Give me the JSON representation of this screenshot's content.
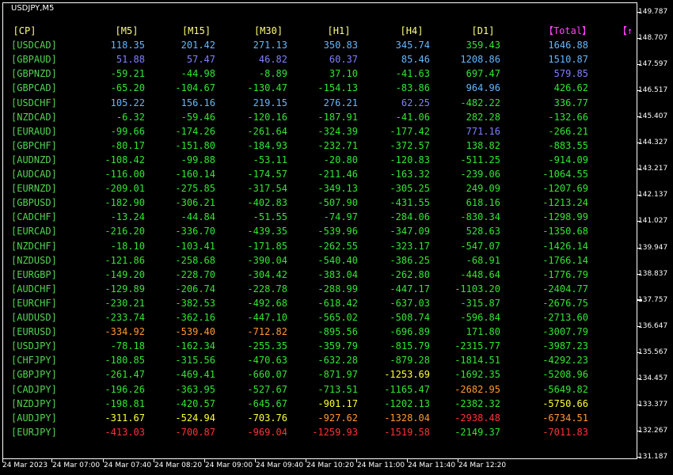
{
  "window": {
    "symbol_title": "USDJPY,M5"
  },
  "colors": {
    "header_yellow": "#ffff80",
    "total_magenta": "#ff40ff",
    "pair_green": "#52d452",
    "positive_blue": "#3aa9ff",
    "light_blue": "#63b8ff",
    "purple": "#8080ff",
    "green": "#33e633",
    "yellow": "#ffff33",
    "orange": "#ff9933",
    "red": "#ff3333",
    "white": "#ffffff"
  },
  "table": {
    "headers": [
      "[CP]",
      "[M5]",
      "[M15]",
      "[M30]",
      "[H1]",
      "[H4]",
      "[D1]",
      "【Total】",
      "【↑"
    ],
    "rows": [
      {
        "pair": "[USDCAD]",
        "values": [
          "118.35",
          "201.42",
          "271.13",
          "350.83",
          "345.74",
          "359.43",
          "1646.88"
        ],
        "tones": [
          "lightblue",
          "lightblue",
          "lightblue",
          "lightblue",
          "lightblue",
          "green",
          "lightblue"
        ]
      },
      {
        "pair": "[GBPAUD]",
        "values": [
          "51.88",
          "57.47",
          "46.82",
          "60.37",
          "85.46",
          "1208.86",
          "1510.87"
        ],
        "tones": [
          "purple",
          "purple",
          "purple",
          "purple",
          "lightblue",
          "lightblue",
          "lightblue"
        ]
      },
      {
        "pair": "[GBPNZD]",
        "values": [
          "-59.21",
          "-44.98",
          "-8.89",
          "37.10",
          "-41.63",
          "697.47",
          "579.85"
        ],
        "tones": [
          "green",
          "green",
          "green",
          "green",
          "green",
          "green",
          "purple"
        ]
      },
      {
        "pair": "[GBPCAD]",
        "values": [
          "-65.20",
          "-104.67",
          "-130.47",
          "-154.13",
          "-83.86",
          "964.96",
          "426.62"
        ],
        "tones": [
          "green",
          "green",
          "green",
          "green",
          "green",
          "lightblue",
          "green"
        ]
      },
      {
        "pair": "[USDCHF]",
        "values": [
          "105.22",
          "156.16",
          "219.15",
          "276.21",
          "62.25",
          "-482.22",
          "336.77"
        ],
        "tones": [
          "lightblue",
          "lightblue",
          "lightblue",
          "lightblue",
          "purple",
          "green",
          "green"
        ]
      },
      {
        "pair": "[NZDCAD]",
        "values": [
          "-6.32",
          "-59.46",
          "-120.16",
          "-187.91",
          "-41.06",
          "282.28",
          "-132.66"
        ],
        "tones": [
          "green",
          "green",
          "green",
          "green",
          "green",
          "green",
          "green"
        ]
      },
      {
        "pair": "[EURAUD]",
        "values": [
          "-99.66",
          "-174.26",
          "-261.64",
          "-324.39",
          "-177.42",
          "771.16",
          "-266.21"
        ],
        "tones": [
          "green",
          "green",
          "green",
          "green",
          "green",
          "purple",
          "green"
        ]
      },
      {
        "pair": "[GBPCHF]",
        "values": [
          "-80.17",
          "-151.80",
          "-184.93",
          "-232.71",
          "-372.57",
          "138.82",
          "-883.55"
        ],
        "tones": [
          "green",
          "green",
          "green",
          "green",
          "green",
          "green",
          "green"
        ]
      },
      {
        "pair": "[AUDNZD]",
        "values": [
          "-108.42",
          "-99.88",
          "-53.11",
          "-20.80",
          "-120.83",
          "-511.25",
          "-914.09"
        ],
        "tones": [
          "green",
          "green",
          "green",
          "green",
          "green",
          "green",
          "green"
        ]
      },
      {
        "pair": "[AUDCAD]",
        "values": [
          "-116.00",
          "-160.14",
          "-174.57",
          "-211.46",
          "-163.32",
          "-239.06",
          "-1064.55"
        ],
        "tones": [
          "green",
          "green",
          "green",
          "green",
          "green",
          "green",
          "green"
        ]
      },
      {
        "pair": "[EURNZD]",
        "values": [
          "-209.01",
          "-275.85",
          "-317.54",
          "-349.13",
          "-305.25",
          "249.09",
          "-1207.69"
        ],
        "tones": [
          "green",
          "green",
          "green",
          "green",
          "green",
          "green",
          "green"
        ]
      },
      {
        "pair": "[GBPUSD]",
        "values": [
          "-182.90",
          "-306.21",
          "-402.83",
          "-507.90",
          "-431.55",
          "618.16",
          "-1213.24"
        ],
        "tones": [
          "green",
          "green",
          "green",
          "green",
          "green",
          "green",
          "green"
        ]
      },
      {
        "pair": "[CADCHF]",
        "values": [
          "-13.24",
          "-44.84",
          "-51.55",
          "-74.97",
          "-284.06",
          "-830.34",
          "-1298.99"
        ],
        "tones": [
          "green",
          "green",
          "green",
          "green",
          "green",
          "green",
          "green"
        ]
      },
      {
        "pair": "[EURCAD]",
        "values": [
          "-216.20",
          "-336.70",
          "-439.35",
          "-539.96",
          "-347.09",
          "528.63",
          "-1350.68"
        ],
        "tones": [
          "green",
          "green",
          "green",
          "green",
          "green",
          "green",
          "green"
        ]
      },
      {
        "pair": "[NZDCHF]",
        "values": [
          "-18.10",
          "-103.41",
          "-171.85",
          "-262.55",
          "-323.17",
          "-547.07",
          "-1426.14"
        ],
        "tones": [
          "green",
          "green",
          "green",
          "green",
          "green",
          "green",
          "green"
        ]
      },
      {
        "pair": "[NZDUSD]",
        "values": [
          "-121.86",
          "-258.68",
          "-390.04",
          "-540.40",
          "-386.25",
          "-68.91",
          "-1766.14"
        ],
        "tones": [
          "green",
          "green",
          "green",
          "green",
          "green",
          "green",
          "green"
        ]
      },
      {
        "pair": "[EURGBP]",
        "values": [
          "-149.20",
          "-228.70",
          "-304.42",
          "-383.04",
          "-262.80",
          "-448.64",
          "-1776.79"
        ],
        "tones": [
          "green",
          "green",
          "green",
          "green",
          "green",
          "green",
          "green"
        ]
      },
      {
        "pair": "[AUDCHF]",
        "values": [
          "-129.89",
          "-206.74",
          "-228.78",
          "-288.99",
          "-447.17",
          "-1103.20",
          "-2404.77"
        ],
        "tones": [
          "green",
          "green",
          "green",
          "green",
          "green",
          "green",
          "green"
        ]
      },
      {
        "pair": "[EURCHF]",
        "values": [
          "-230.21",
          "-382.53",
          "-492.68",
          "-618.42",
          "-637.03",
          "-315.87",
          "-2676.75"
        ],
        "tones": [
          "green",
          "green",
          "green",
          "green",
          "green",
          "green",
          "green"
        ]
      },
      {
        "pair": "[AUDUSD]",
        "values": [
          "-233.74",
          "-362.16",
          "-447.10",
          "-565.02",
          "-508.74",
          "-596.84",
          "-2713.60"
        ],
        "tones": [
          "green",
          "green",
          "green",
          "green",
          "green",
          "green",
          "green"
        ]
      },
      {
        "pair": "[EURUSD]",
        "values": [
          "-334.92",
          "-539.40",
          "-712.82",
          "-895.56",
          "-696.89",
          "171.80",
          "-3007.79"
        ],
        "tones": [
          "orange",
          "orange",
          "orange",
          "green",
          "green",
          "green",
          "green"
        ]
      },
      {
        "pair": "[USDJPY]",
        "values": [
          "-78.18",
          "-162.34",
          "-255.35",
          "-359.79",
          "-815.79",
          "-2315.77",
          "-3987.23"
        ],
        "tones": [
          "green",
          "green",
          "green",
          "green",
          "green",
          "green",
          "green"
        ]
      },
      {
        "pair": "[CHFJPY]",
        "values": [
          "-180.85",
          "-315.56",
          "-470.63",
          "-632.28",
          "-879.28",
          "-1814.51",
          "-4292.23"
        ],
        "tones": [
          "green",
          "green",
          "green",
          "green",
          "green",
          "green",
          "green"
        ]
      },
      {
        "pair": "[GBPJPY]",
        "values": [
          "-261.47",
          "-469.41",
          "-660.07",
          "-871.97",
          "-1253.69",
          "-1692.35",
          "-5208.96"
        ],
        "tones": [
          "green",
          "green",
          "green",
          "green",
          "yellow",
          "green",
          "green"
        ]
      },
      {
        "pair": "[CADJPY]",
        "values": [
          "-196.26",
          "-363.95",
          "-527.67",
          "-713.51",
          "-1165.47",
          "-2682.95",
          "-5649.82"
        ],
        "tones": [
          "green",
          "green",
          "green",
          "green",
          "green",
          "orange",
          "green"
        ]
      },
      {
        "pair": "[NZDJPY]",
        "values": [
          "-198.81",
          "-420.57",
          "-645.67",
          "-901.17",
          "-1202.13",
          "-2382.32",
          "-5750.66"
        ],
        "tones": [
          "green",
          "green",
          "green",
          "yellow",
          "green",
          "green",
          "yellow"
        ]
      },
      {
        "pair": "[AUDJPY]",
        "values": [
          "-311.67",
          "-524.94",
          "-703.76",
          "-927.62",
          "-1328.04",
          "-2938.48",
          "-6734.51"
        ],
        "tones": [
          "yellow",
          "yellow",
          "yellow",
          "orange",
          "orange",
          "red",
          "orange"
        ]
      },
      {
        "pair": "[EURJPY]",
        "values": [
          "-413.03",
          "-700.87",
          "-969.04",
          "-1259.93",
          "-1519.58",
          "-2149.37",
          "-7011.83"
        ],
        "tones": [
          "red",
          "red",
          "red",
          "red",
          "red",
          "green",
          "red"
        ]
      }
    ]
  },
  "price_axis": {
    "labels": [
      "149.787",
      "148.707",
      "147.597",
      "146.517",
      "145.407",
      "144.327",
      "143.217",
      "142.137",
      "141.027",
      "139.947",
      "138.837",
      "137.757",
      "136.647",
      "135.567",
      "134.457",
      "133.377",
      "132.267",
      "131.187"
    ]
  },
  "time_axis": {
    "labels": [
      "24 Mar 2023",
      "24 Mar 07:00",
      "24 Mar 07:40",
      "24 Mar 08:20",
      "24 Mar 09:00",
      "24 Mar 09:40",
      "24 Mar 10:20",
      "24 Mar 11:00",
      "24 Mar 11:40",
      "24 Mar 12:20"
    ]
  }
}
